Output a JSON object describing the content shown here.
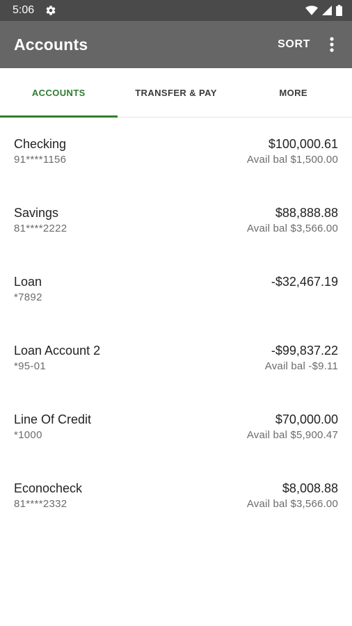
{
  "status_bar": {
    "time": "5:06"
  },
  "app_bar": {
    "title": "Accounts",
    "sort_label": "SORT"
  },
  "tabs": [
    {
      "label": "ACCOUNTS",
      "active": true
    },
    {
      "label": "TRANSFER & PAY",
      "active": false
    },
    {
      "label": "MORE",
      "active": false
    }
  ],
  "accounts": [
    {
      "name": "Checking",
      "number": "91****1156",
      "balance": "$100,000.61",
      "available": "Avail bal $1,500.00"
    },
    {
      "name": "Savings",
      "number": "81****2222",
      "balance": "$88,888.88",
      "available": "Avail bal $3,566.00"
    },
    {
      "name": "Loan",
      "number": "*7892",
      "balance": "-$32,467.19",
      "available": ""
    },
    {
      "name": "Loan Account 2",
      "number": "*95-01",
      "balance": "-$99,837.22",
      "available": "Avail bal -$9.11"
    },
    {
      "name": "Line Of Credit",
      "number": "*1000",
      "balance": "$70,000.00",
      "available": "Avail bal $5,900.47"
    },
    {
      "name": "Econocheck",
      "number": "81****2332",
      "balance": "$8,008.88",
      "available": "Avail bal $3,566.00"
    }
  ],
  "colors": {
    "status_bar": "#4a4a4a",
    "app_bar": "#666666",
    "accent": "#2e7d32"
  },
  "icons": [
    "gear-icon",
    "wifi-icon",
    "signal-icon",
    "battery-icon",
    "overflow-menu-icon"
  ]
}
